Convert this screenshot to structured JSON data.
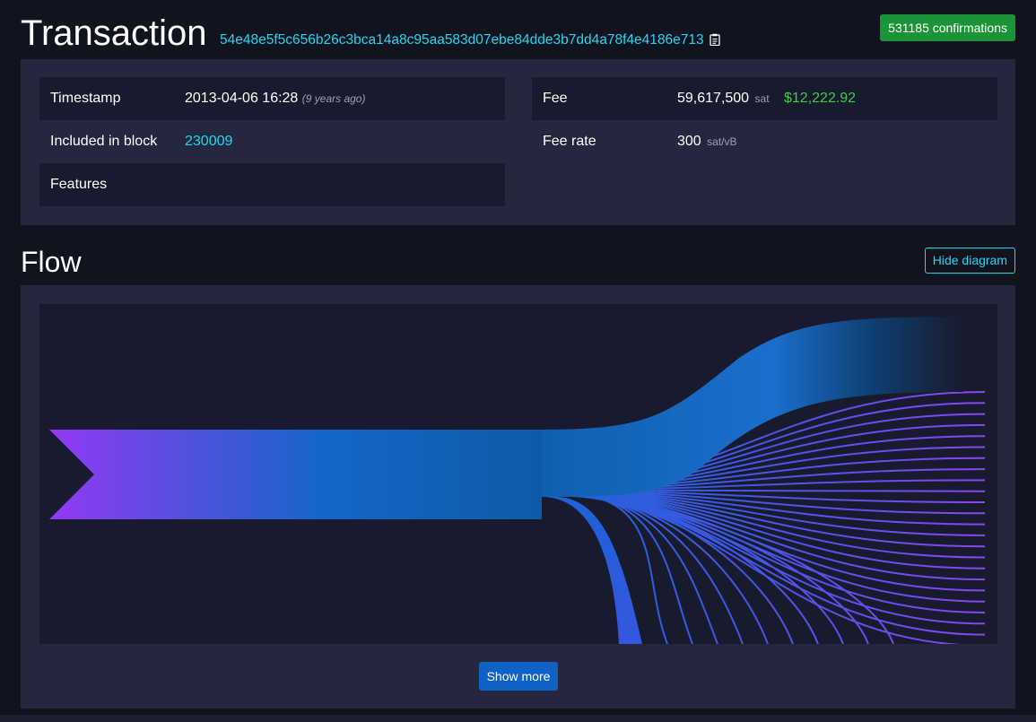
{
  "header": {
    "title": "Transaction",
    "txid": "54e48e5f5c656b26c3bca14a8c95aa583d07ebe84dde3b7dd4a78f4e4186e713",
    "copy_icon": "clipboard-icon",
    "confirmations": "531185 confirmations"
  },
  "details": {
    "left": [
      {
        "label": "Timestamp",
        "value": "2013-04-06 16:28",
        "sub": "(9 years ago)"
      },
      {
        "label": "Included in block",
        "value": "230009"
      },
      {
        "label": "Features",
        "value": ""
      }
    ],
    "right": [
      {
        "label": "Fee",
        "value": "59,617,500",
        "unit": "sat",
        "usd": "$12,222.92"
      },
      {
        "label": "Fee rate",
        "value": "300",
        "unit": "sat/vB"
      }
    ]
  },
  "flow": {
    "title": "Flow",
    "hide_button": "Hide diagram",
    "show_more": "Show more",
    "output_lines_shown": 24
  },
  "colors": {
    "link": "#1bd8f4",
    "badge": "#1a9436",
    "usd": "#3bcc49",
    "flow_start": "#9339f4",
    "flow_end": "#105fb0"
  }
}
